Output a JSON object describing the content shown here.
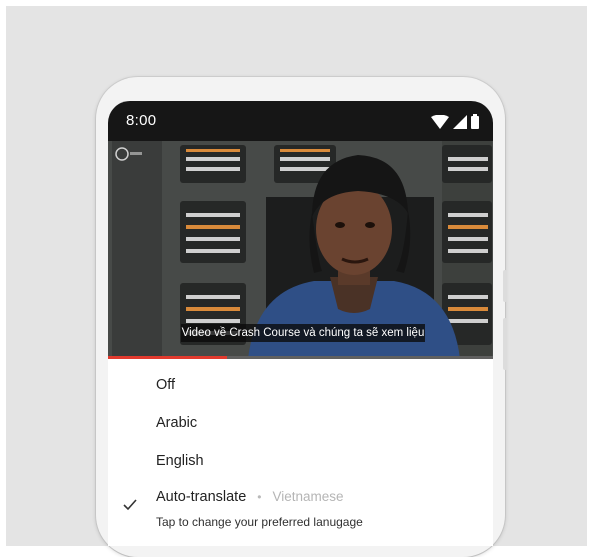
{
  "status_bar": {
    "time": "8:00",
    "icons": [
      "wifi-icon",
      "cell-signal-icon",
      "battery-icon"
    ]
  },
  "video": {
    "caption": "Video về Crash Course và chúng ta sẽ xem liệu",
    "channel_logo": "pbs-icon",
    "progress": 0.31,
    "progress_color": "#e23a2e"
  },
  "caption_menu": {
    "items": [
      {
        "label": "Off",
        "selected": false
      },
      {
        "label": "Arabic",
        "selected": false
      },
      {
        "label": "English",
        "selected": false
      }
    ],
    "auto_translate": {
      "label": "Auto-translate",
      "separator": "•",
      "language": "Vietnamese",
      "hint": "Tap to change your preferred lanugage",
      "selected": true
    }
  },
  "colors": {
    "background": "#e4e4e4",
    "status_bar": "#161616",
    "sheet": "#ffffff"
  }
}
